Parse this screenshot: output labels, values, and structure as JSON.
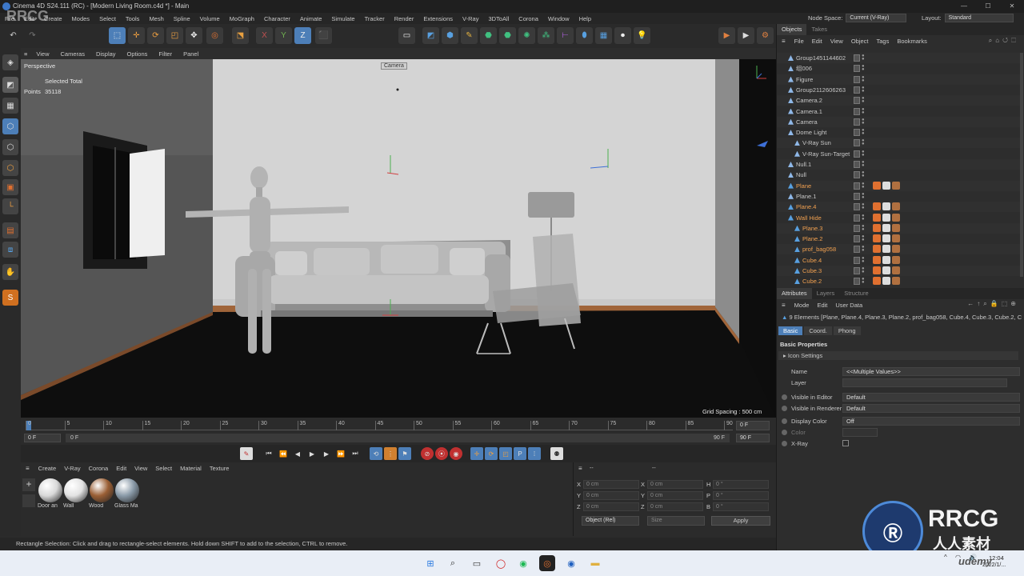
{
  "window": {
    "title": "Cinema 4D S24.111 (RC) - [Modern Living Room.c4d *] - Main",
    "controls": [
      "—",
      "☐",
      "✕"
    ]
  },
  "menu": [
    "File",
    "Edit",
    "Create",
    "Modes",
    "Select",
    "Tools",
    "Mesh",
    "Spline",
    "Volume",
    "MoGraph",
    "Character",
    "Animate",
    "Simulate",
    "Tracker",
    "Render",
    "Extensions",
    "V-Ray",
    "3DToAll",
    "Corona",
    "Window",
    "Help"
  ],
  "node_space": {
    "label": "Node Space:",
    "value": "Current (V-Ray)"
  },
  "layout": {
    "label": "Layout:",
    "value": "Standard"
  },
  "viewport": {
    "menu": [
      "View",
      "Cameras",
      "Display",
      "Options",
      "Filter",
      "Panel"
    ],
    "name": "Perspective",
    "camera_label": "Camera",
    "selected_label": "Selected Total",
    "points_label": "Points",
    "points_value": "35118",
    "grid_spacing": "Grid Spacing : 500 cm"
  },
  "timeline": {
    "ticks": [
      "0",
      "5",
      "10",
      "15",
      "20",
      "25",
      "30",
      "35",
      "40",
      "45",
      "50",
      "55",
      "60",
      "65",
      "70",
      "75",
      "80",
      "85",
      "90"
    ],
    "current_frame": "0 F",
    "start": "0 F",
    "start2": "0 F",
    "end": "90 F",
    "end2": "90 F"
  },
  "material_manager": {
    "menu": [
      "Create",
      "V-Ray",
      "Corona",
      "Edit",
      "View",
      "Select",
      "Material",
      "Texture"
    ],
    "materials": [
      {
        "name": "Door an",
        "color": "#d9d9d9"
      },
      {
        "name": "Wall",
        "color": "#e3e3e3"
      },
      {
        "name": "Wood",
        "color": "#9a5f35"
      },
      {
        "name": "Glass Ma",
        "color": "#8a9aa8"
      }
    ]
  },
  "coordinates": {
    "header_left": "--",
    "header_right": "--",
    "rows": [
      {
        "a": "X",
        "av": "0 cm",
        "b": "X",
        "bv": "0 cm",
        "c": "H",
        "cv": "0 °"
      },
      {
        "a": "Y",
        "av": "0 cm",
        "b": "Y",
        "bv": "0 cm",
        "c": "P",
        "cv": "0 °"
      },
      {
        "a": "Z",
        "av": "0 cm",
        "b": "Z",
        "bv": "0 cm",
        "c": "B",
        "cv": "0 °"
      }
    ],
    "mode": "Object (Rel)",
    "size": "Size",
    "apply": "Apply"
  },
  "status": "Rectangle Selection: Click and drag to rectangle-select elements. Hold down SHIFT to add to the selection, CTRL to remove.",
  "objects_panel": {
    "tabs": [
      "Objects",
      "Takes"
    ],
    "menu": [
      "File",
      "Edit",
      "View",
      "Object",
      "Tags",
      "Bookmarks"
    ],
    "items": [
      {
        "name": "Group1451144602",
        "color": "#c8c8c8",
        "indent": 0
      },
      {
        "name": "组006",
        "color": "#c8c8c8",
        "indent": 0
      },
      {
        "name": "Figure",
        "color": "#c8c8c8",
        "indent": 0
      },
      {
        "name": "Group2112606263",
        "color": "#c8c8c8",
        "indent": 0
      },
      {
        "name": "Camera.2",
        "color": "#c8c8c8",
        "indent": 0
      },
      {
        "name": "Camera.1",
        "color": "#c8c8c8",
        "indent": 0
      },
      {
        "name": "Camera",
        "color": "#c8c8c8",
        "indent": 0
      },
      {
        "name": "Dome Light",
        "color": "#c8c8c8",
        "indent": 0
      },
      {
        "name": "V-Ray Sun",
        "color": "#c8c8c8",
        "indent": 1
      },
      {
        "name": "V-Ray Sun-Target",
        "color": "#c8c8c8",
        "indent": 1
      },
      {
        "name": "Null.1",
        "color": "#c8c8c8",
        "indent": 0
      },
      {
        "name": "Null",
        "color": "#c8c8c8",
        "indent": 0
      },
      {
        "name": "Plane",
        "color": "#f0a050",
        "indent": 0
      },
      {
        "name": "Plane.1",
        "color": "#c8c8c8",
        "indent": 0
      },
      {
        "name": "Plane.4",
        "color": "#f0a050",
        "indent": 0
      },
      {
        "name": "Wall Hide",
        "color": "#f0a050",
        "indent": 0
      },
      {
        "name": "Plane.3",
        "color": "#f0a050",
        "indent": 1
      },
      {
        "name": "Plane.2",
        "color": "#f0a050",
        "indent": 1
      },
      {
        "name": "prof_bag058",
        "color": "#f0a050",
        "indent": 1
      },
      {
        "name": "Cube.4",
        "color": "#f0a050",
        "indent": 1
      },
      {
        "name": "Cube.3",
        "color": "#f0a050",
        "indent": 1
      },
      {
        "name": "Cube.2",
        "color": "#f0a050",
        "indent": 1
      }
    ]
  },
  "attributes_panel": {
    "tabs": [
      "Attributes",
      "Layers",
      "Structure"
    ],
    "menu": [
      "Mode",
      "Edit",
      "User Data"
    ],
    "selection": "9 Elements [Plane, Plane.4, Plane.3, Plane.2, prof_bag058, Cube.4, Cube.3, Cube.2, Cube]",
    "subtabs": [
      "Basic",
      "Coord.",
      "Phong"
    ],
    "section": "Basic Properties",
    "icon_settings": "Icon Settings",
    "fields": [
      {
        "label": "Name",
        "value": "<<Multiple Values>>"
      },
      {
        "label": "Layer",
        "value": ""
      },
      {
        "label": "Visible in Editor",
        "value": "Default"
      },
      {
        "label": "Visible in Renderer",
        "value": "Default"
      },
      {
        "label": "Display Color",
        "value": "Off"
      },
      {
        "label": "Color",
        "value": ""
      },
      {
        "label": "X-Ray",
        "value": ""
      }
    ]
  },
  "taskbar": {
    "time": "12:04",
    "date": "2022/1/..."
  },
  "watermark": {
    "brand": "RRCG",
    "sub": "人人素材",
    "udemy": "udemy"
  }
}
